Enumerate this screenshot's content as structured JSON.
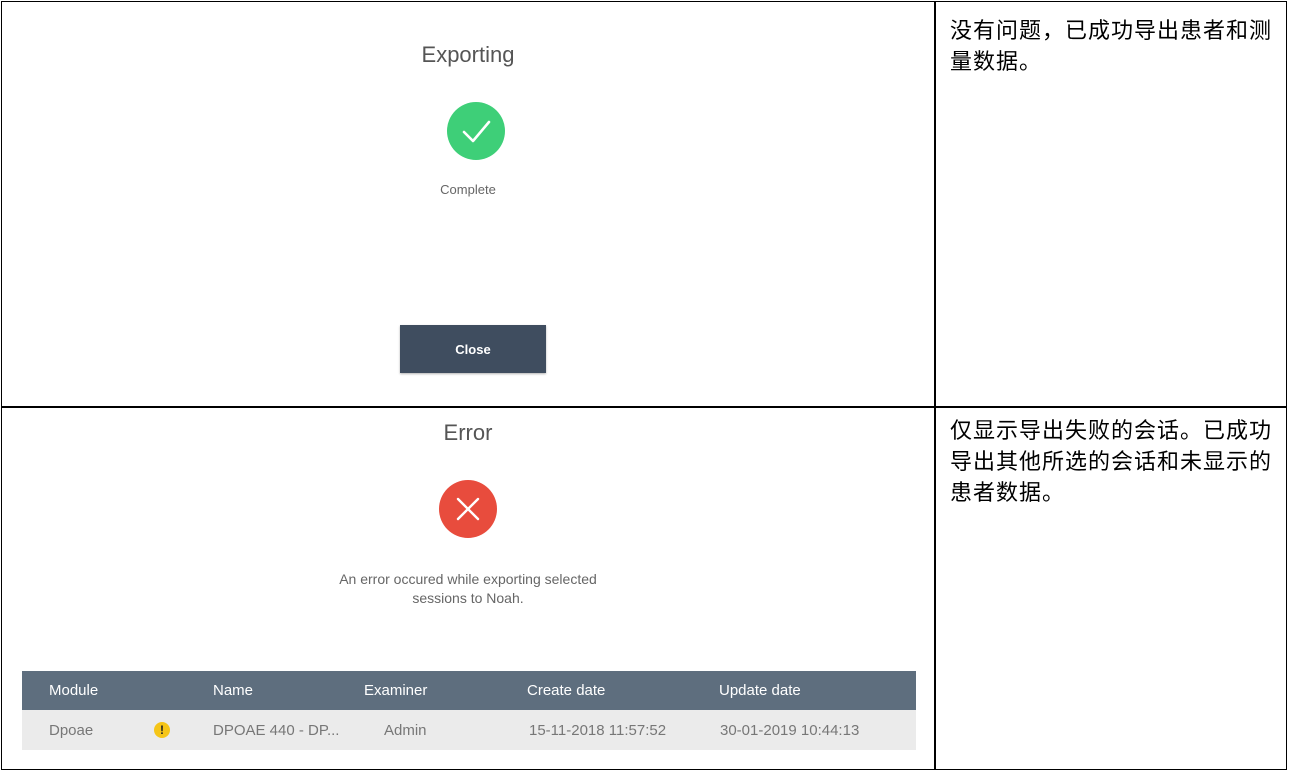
{
  "export_success": {
    "title": "Exporting",
    "status": "Complete",
    "close_label": "Close",
    "note": "没有问题，已成功导出患者和测量数据。",
    "icon": "check-icon",
    "icon_color": "#3ecf78"
  },
  "export_error": {
    "title": "Error",
    "message_line1": "An error occured while exporting selected",
    "message_line2": "sessions to Noah.",
    "note": "仅显示导出失败的会话。已成功导出其他所选的会话和未显示的患者数据。",
    "icon": "x-icon",
    "icon_color": "#e84c3d",
    "table": {
      "columns": [
        "Module",
        "Name",
        "Examiner",
        "Create date",
        "Update date"
      ],
      "rows": [
        {
          "module": "Dpoae",
          "status_icon": "warning-icon",
          "name": "DPOAE 440 - DP...",
          "examiner": "Admin",
          "create_date": "15-11-2018 11:57:52",
          "update_date": "30-01-2019 10:44:13"
        }
      ]
    }
  },
  "colors": {
    "header_bg": "#5e6e7e",
    "row_bg": "#ebebeb",
    "button_bg": "#3f4d5f",
    "warning": "#f5c518"
  }
}
